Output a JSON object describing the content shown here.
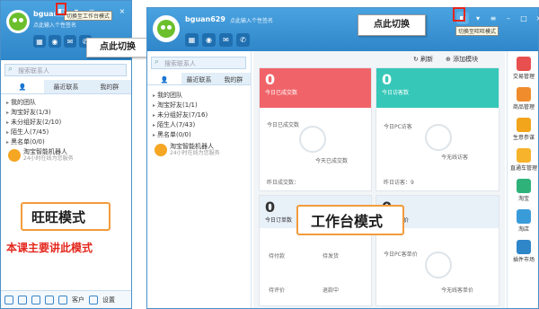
{
  "wangwang": {
    "username": "bguan",
    "signature": "点此输入个性签名",
    "tooltip": "切换至工作台模式",
    "search_placeholder": "搜索联系人",
    "tabs": [
      "",
      "最近联系",
      "我的群"
    ],
    "tree": [
      "我的团队",
      "淘宝好友(1/3)",
      "未分组好友(2/10)",
      "陌生人(7/45)",
      "黑名单(0/0)"
    ],
    "robot_name": "淘宝智能机器人",
    "robot_status": "24小时在线为您服务",
    "mode_label": "旺旺模式",
    "note": "本课主要讲此模式",
    "footer_items": [
      "",
      "",
      "",
      "",
      "客户",
      "设置"
    ]
  },
  "callouts": {
    "left": "点此切换",
    "right": "点此切换"
  },
  "workbench": {
    "username": "bguan629",
    "signature": "点此输入个性签名",
    "tooltip": "切换至旺旺模式",
    "search_placeholder": "搜索联系人",
    "tabs": [
      "",
      "最近联系",
      "我的群"
    ],
    "tree": [
      "我的团队",
      "淘宝好友(1/1)",
      "未分组好友(7/16)",
      "陌生人(7/43)",
      "黑名单(0/0)"
    ],
    "robot_name": "淘宝智能机器人",
    "robot_status": "24小时在线为您服务",
    "refresh": "刷新",
    "add_module": "添加模块",
    "cards": {
      "c1": {
        "num": "0",
        "label": "今日已成交数",
        "a": "今日已成交数",
        "b": "今天已成交数",
        "foot": "昨日成交数：",
        "color": "#f06469"
      },
      "c2": {
        "num": "0",
        "label": "今日访客数",
        "a": "今日PC访客",
        "b": "今无线访客",
        "foot": "昨日访客：9",
        "color": "#36c7b8"
      },
      "c3": {
        "num": "0",
        "label": "今日订单数",
        "a": "待付款",
        "b": "待发货",
        "c": "待评价",
        "d": "退款中",
        "color": "#e8f0f8"
      },
      "c4": {
        "num": "0",
        "label": "今日客单价",
        "a": "今日PC客单价",
        "b": "今无线客单价",
        "color": "#e8f0f8"
      }
    },
    "mode_label": "工作台模式",
    "right_items": [
      "交易管理",
      "商品管理",
      "生意参谋",
      "直通车管理",
      "淘宝",
      "淘店",
      "插件市场"
    ]
  }
}
